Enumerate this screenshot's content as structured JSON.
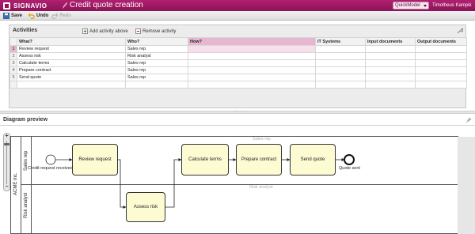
{
  "app": {
    "brand": "SIGNAVIO",
    "title": "Credit quote creation",
    "model_select": "QuickModel",
    "user": "Timotheus Kampik"
  },
  "toolbar": {
    "save": "Save",
    "undo": "Undo",
    "redo": "Redo"
  },
  "activities": {
    "title": "Activities",
    "add_label": "Add activity above",
    "remove_label": "Remove activity",
    "columns": [
      "What?",
      "Who?",
      "How?",
      "IT Systems",
      "Input documents",
      "Output documents"
    ],
    "rows": [
      {
        "n": "1",
        "what": "Review request",
        "who": "Sales rep"
      },
      {
        "n": "2",
        "what": "Assess risk",
        "who": "Risk analyst"
      },
      {
        "n": "3",
        "what": "Calculate terms",
        "who": "Sales rep"
      },
      {
        "n": "4",
        "what": "Prepare contract",
        "who": "Sales rep"
      },
      {
        "n": "5",
        "what": "Send quote",
        "who": "Sales rep"
      }
    ]
  },
  "diagram": {
    "title": "Diagram preview",
    "pool": "ACME Inc.",
    "lanes": [
      "Sales rep",
      "Risk analyst"
    ],
    "start_event": "Credit request received",
    "end_event": "Quote sent",
    "tasks": {
      "review": "Review request",
      "assess": "Assess risk",
      "calculate": "Calculate terms",
      "prepare": "Prepare contract",
      "send": "Send quote"
    },
    "zoom_plus": "+",
    "zoom_minus": "−"
  }
}
